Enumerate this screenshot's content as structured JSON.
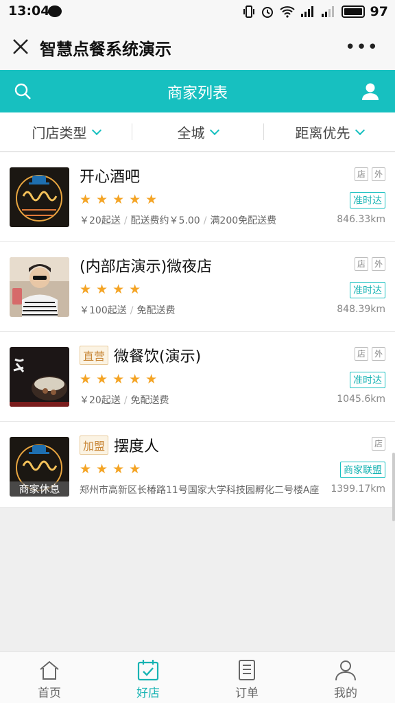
{
  "status_bar": {
    "time": "13:04",
    "battery": "97"
  },
  "title_bar": {
    "title": "智慧点餐系统演示",
    "more": "•••"
  },
  "header": {
    "title": "商家列表"
  },
  "filters": [
    {
      "label": "门店类型"
    },
    {
      "label": "全城"
    },
    {
      "label": "距离优先"
    }
  ],
  "merchants": [
    {
      "name": "开心酒吧",
      "tag": "",
      "stars": "★★★★★",
      "min_order": "￥20起送",
      "delivery_fee": "配送费约￥5.00",
      "promo": "满200免配送费",
      "badges": [
        "店",
        "外"
      ],
      "status": "准时达",
      "distance": "846.33km"
    },
    {
      "name": "(内部店演示)微夜店",
      "tag": "",
      "stars": "★★★★",
      "min_order": "￥100起送",
      "delivery_fee": "免配送费",
      "badges": [
        "店",
        "外"
      ],
      "status": "准时达",
      "distance": "848.39km"
    },
    {
      "name": "微餐饮(演示)",
      "tag": "直营",
      "stars": "★★★★★",
      "min_order": "￥20起送",
      "delivery_fee": "免配送费",
      "badges": [
        "店",
        "外"
      ],
      "status": "准时达",
      "distance": "1045.6km"
    },
    {
      "name": "摆度人",
      "tag": "加盟",
      "stars": "★★★★",
      "address": "郑州市高新区长椿路11号国家大学科技园孵化二号楼A座",
      "badges": [
        "店"
      ],
      "status": "商家联盟",
      "distance": "1399.17km",
      "closed_label": "商家休息"
    }
  ],
  "tabs": [
    {
      "label": "首页",
      "icon": "home-icon"
    },
    {
      "label": "好店",
      "icon": "store-calendar-icon",
      "active": true
    },
    {
      "label": "订单",
      "icon": "order-icon"
    },
    {
      "label": "我的",
      "icon": "profile-icon"
    }
  ],
  "colors": {
    "accent": "#17c0c0",
    "star": "#f4a425",
    "tag": "#c9893b"
  }
}
